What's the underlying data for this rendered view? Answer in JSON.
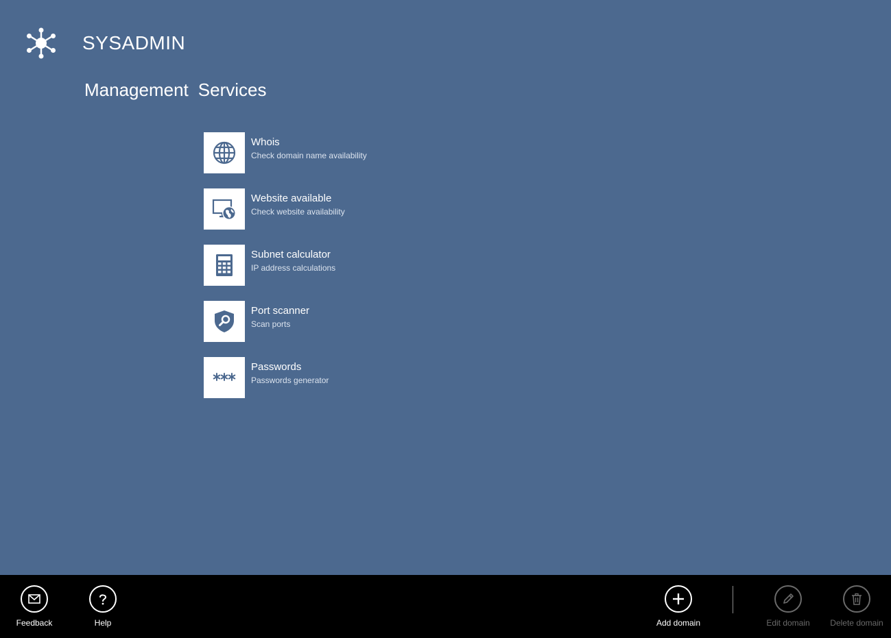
{
  "app": {
    "title": "SYSADMIN",
    "logo_icon": "network-hub-icon"
  },
  "nav": {
    "tabs": [
      {
        "label": "Management"
      },
      {
        "label": "Services"
      }
    ]
  },
  "services": {
    "items": [
      {
        "title": "Whois",
        "subtitle": "Check domain name availability",
        "icon": "globe-icon"
      },
      {
        "title": "Website available",
        "subtitle": "Check website availability",
        "icon": "monitor-globe-icon"
      },
      {
        "title": "Subnet calculator",
        "subtitle": "IP address calculations",
        "icon": "calculator-icon"
      },
      {
        "title": "Port scanner",
        "subtitle": "Scan ports",
        "icon": "shield-search-icon"
      },
      {
        "title": "Passwords",
        "subtitle": "Passwords generator",
        "icon": "asterisks-icon"
      }
    ]
  },
  "app_bar": {
    "feedback": {
      "label": "Feedback",
      "icon": "mail-icon",
      "enabled": true
    },
    "help": {
      "label": "Help",
      "icon": "question-icon",
      "enabled": true
    },
    "add_domain": {
      "label": "Add domain",
      "icon": "plus-icon",
      "enabled": true
    },
    "edit_domain": {
      "label": "Edit domain",
      "icon": "pencil-icon",
      "enabled": false
    },
    "delete_domain": {
      "label": "Delete domain",
      "icon": "trash-icon",
      "enabled": false
    }
  },
  "colors": {
    "background": "#4c698f",
    "tile": "#ffffff",
    "icon": "#4c698f",
    "app_bar": "#000000",
    "disabled": "#6a6a6a"
  }
}
